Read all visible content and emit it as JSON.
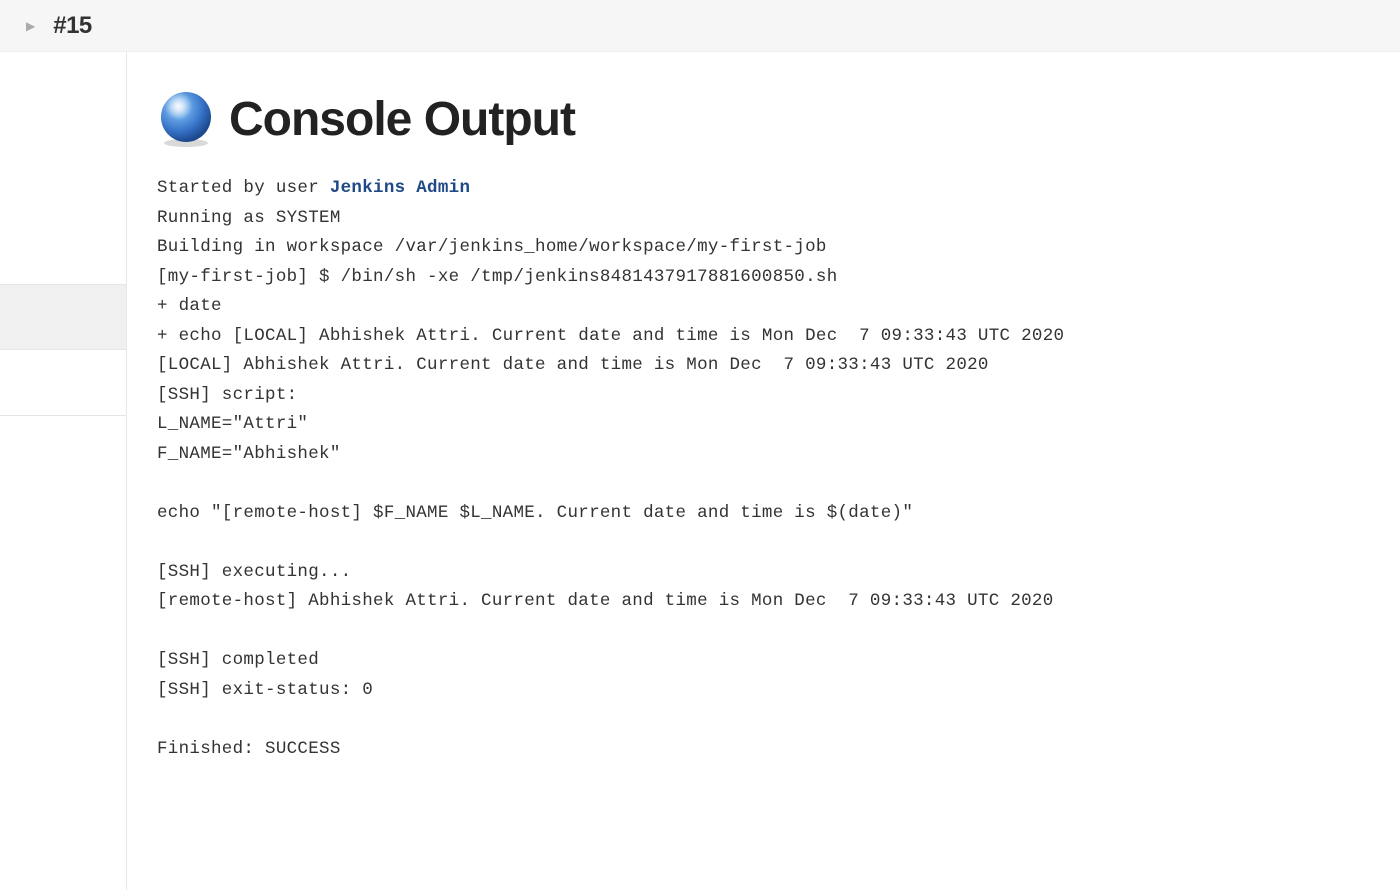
{
  "breadcrumb": {
    "build_label": "#15"
  },
  "page": {
    "title": "Console Output"
  },
  "console": {
    "started_prefix": "Started by user ",
    "started_user": "Jenkins Admin",
    "lines": [
      "Running as SYSTEM",
      "Building in workspace /var/jenkins_home/workspace/my-first-job",
      "[my-first-job] $ /bin/sh -xe /tmp/jenkins8481437917881600850.sh",
      "+ date",
      "+ echo [LOCAL] Abhishek Attri. Current date and time is Mon Dec  7 09:33:43 UTC 2020",
      "[LOCAL] Abhishek Attri. Current date and time is Mon Dec  7 09:33:43 UTC 2020",
      "[SSH] script:",
      "L_NAME=\"Attri\"",
      "F_NAME=\"Abhishek\"",
      "",
      "echo \"[remote-host] $F_NAME $L_NAME. Current date and time is $(date)\"",
      "",
      "[SSH] executing...",
      "[remote-host] Abhishek Attri. Current date and time is Mon Dec  7 09:33:43 UTC 2020",
      "",
      "[SSH] completed",
      "[SSH] exit-status: 0",
      "",
      "Finished: SUCCESS"
    ]
  }
}
